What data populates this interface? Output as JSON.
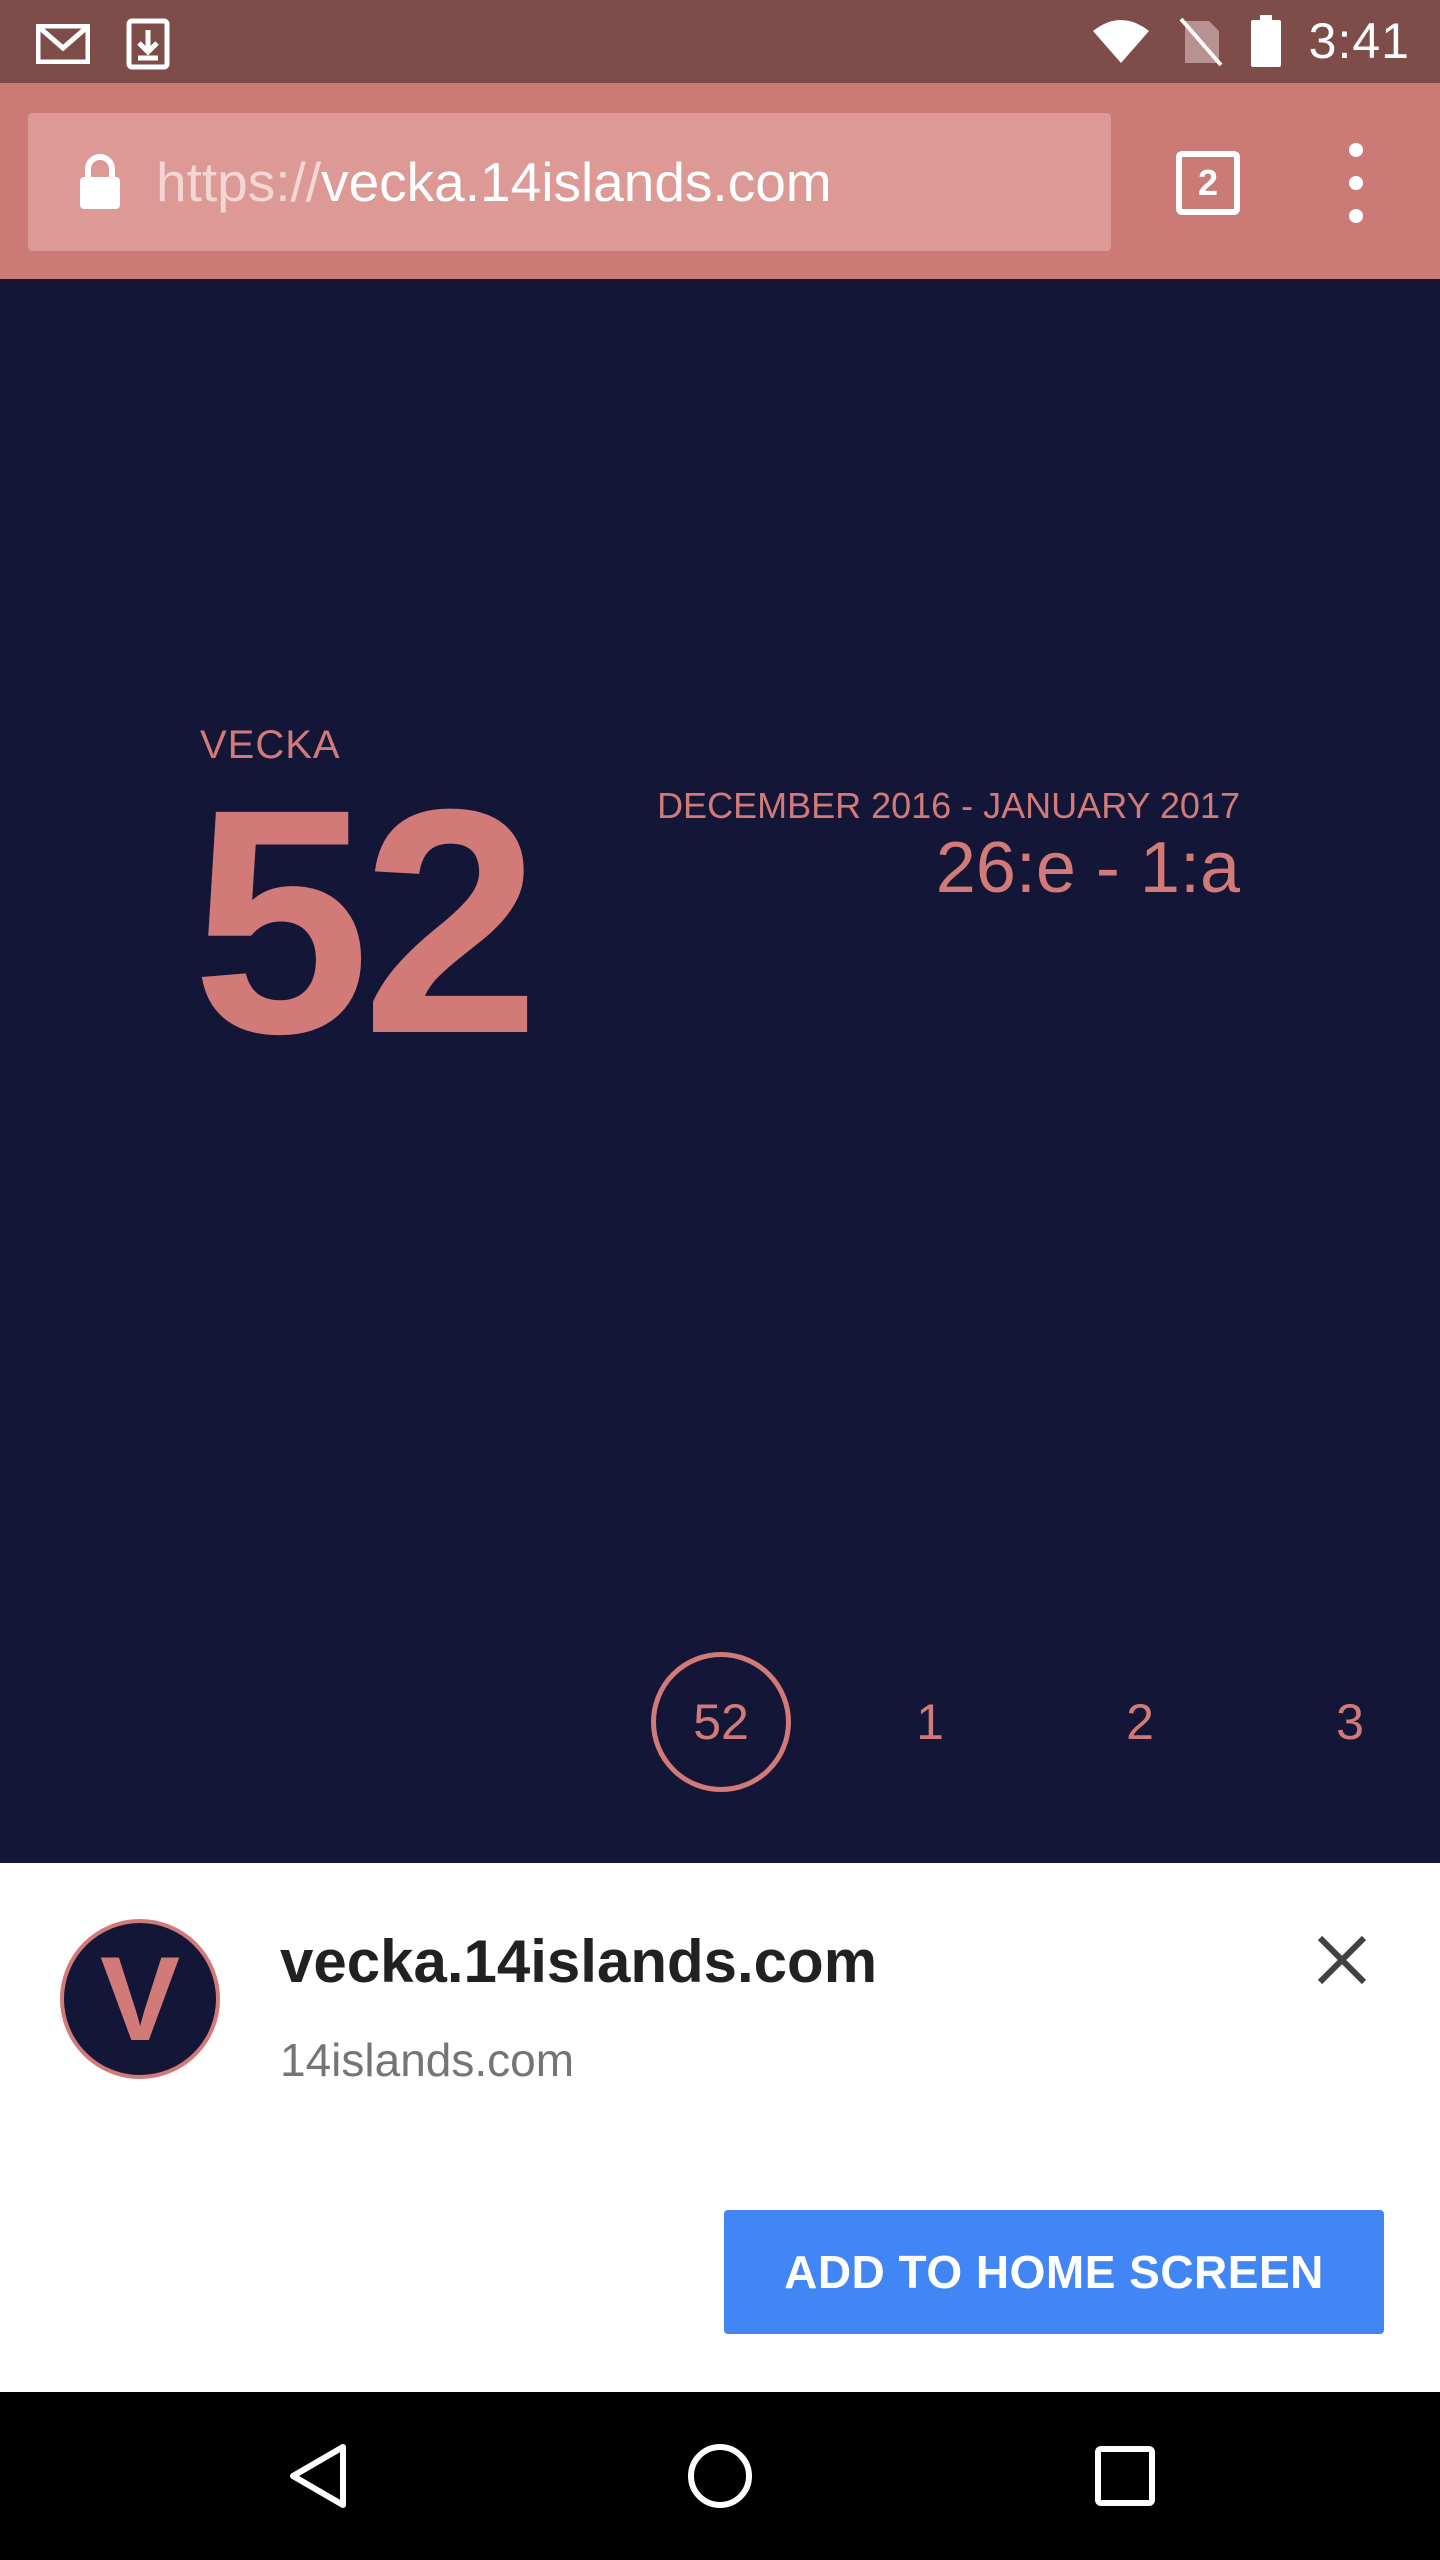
{
  "status_bar": {
    "time": "3:41",
    "icons": [
      "gmail-icon",
      "download-icon",
      "wifi-icon",
      "no-sim-icon",
      "battery-icon"
    ]
  },
  "browser": {
    "url_scheme": "https://",
    "url_host": "vecka.14islands.com",
    "tab_count": "2"
  },
  "page": {
    "label": "VECKA",
    "week_number": "52",
    "month_range": "DECEMBER 2016 - JANUARY 2017",
    "day_range": "26:e - 1:a",
    "weeks": [
      "52",
      "1",
      "2",
      "3"
    ],
    "active_week": "52"
  },
  "banner": {
    "icon_letter": "V",
    "title": "vecka.14islands.com",
    "subtitle": "14islands.com",
    "add_button": "ADD TO HOME SCREEN"
  },
  "colors": {
    "page_bg": "#141637",
    "accent": "#d27a78",
    "toolbar": "#cc7a76",
    "status_bar": "#7e4d49",
    "button": "#4285f4"
  }
}
